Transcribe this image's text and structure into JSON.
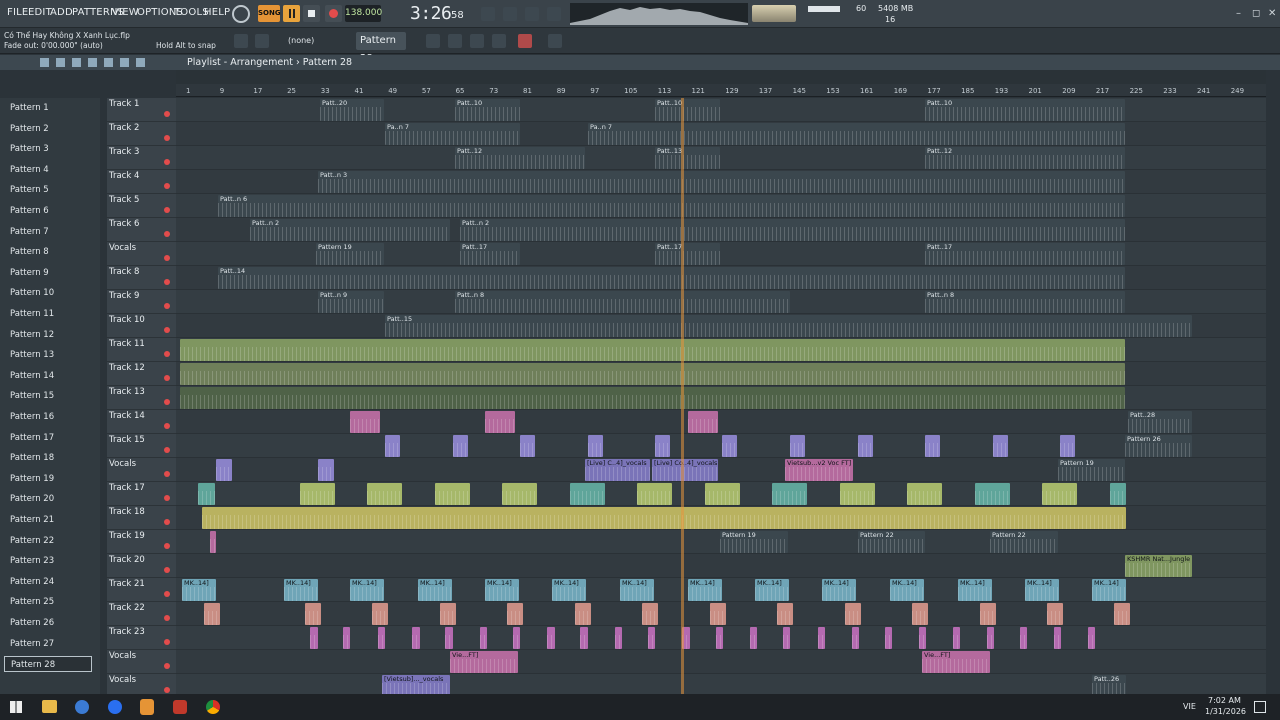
{
  "menu": [
    "FILE",
    "EDIT",
    "ADD",
    "PATTERNS",
    "VIEW",
    "OPTIONS",
    "TOOLS",
    "HELP"
  ],
  "transport": {
    "song_label": "SONG",
    "bpm": "138.000",
    "time": "3:26",
    "time_ms": "58"
  },
  "monitor": {
    "cpu": "60",
    "ram": "5408 MB",
    "poly": "16"
  },
  "hints": {
    "project": "Có Thể Hay Không X Xanh Lục.flp",
    "fade": "Fade out: 0'00.000\" (auto)",
    "snap": "Hold Alt to snap",
    "none": "(none)"
  },
  "pattern_selector": "Pattern 28",
  "playlist_title": "Playlist - Arrangement",
  "playlist_pattern": "Pattern 28",
  "ruler": [
    "1",
    "9",
    "17",
    "25",
    "33",
    "41",
    "49",
    "57",
    "65",
    "73",
    "81",
    "89",
    "97",
    "105",
    "113",
    "121",
    "129",
    "137",
    "145",
    "153",
    "161",
    "169",
    "177",
    "185",
    "193",
    "201",
    "209",
    "217",
    "225",
    "233",
    "241",
    "249"
  ],
  "patterns": [
    "Pattern 1",
    "Pattern 2",
    "Pattern 3",
    "Pattern 4",
    "Pattern 5",
    "Pattern 6",
    "Pattern 7",
    "Pattern 8",
    "Pattern 9",
    "Pattern 10",
    "Pattern 11",
    "Pattern 12",
    "Pattern 13",
    "Pattern 14",
    "Pattern 15",
    "Pattern 16",
    "Pattern 17",
    "Pattern 18",
    "Pattern 19",
    "Pattern 20",
    "Pattern 21",
    "Pattern 22",
    "Pattern 23",
    "Pattern 24",
    "Pattern 25",
    "Pattern 26",
    "Pattern 27",
    "Pattern 28"
  ],
  "selected_pattern": "Pattern 28",
  "tracks": [
    {
      "name": "Track 1",
      "clips": [
        {
          "s": 320,
          "e": 384,
          "label": "Patt..20",
          "c": "#3b474e"
        },
        {
          "s": 455,
          "e": 520,
          "label": "Patt..10",
          "c": "#3b474e"
        },
        {
          "s": 655,
          "e": 720,
          "label": "Patt..10",
          "c": "#3b474e"
        },
        {
          "s": 925,
          "e": 1125,
          "label": "Patt..10",
          "c": "#3b474e"
        }
      ]
    },
    {
      "name": "Track 2",
      "clips": [
        {
          "s": 385,
          "e": 520,
          "label": "Pa..n 7",
          "c": "#3b474e"
        },
        {
          "s": 588,
          "e": 1125,
          "label": "Pa..n 7",
          "c": "#3b474e"
        }
      ]
    },
    {
      "name": "Track 3",
      "clips": [
        {
          "s": 455,
          "e": 585,
          "label": "Patt..12",
          "c": "#3b474e"
        },
        {
          "s": 655,
          "e": 720,
          "label": "Patt..13",
          "c": "#3b474e"
        },
        {
          "s": 925,
          "e": 1125,
          "label": "Patt..12",
          "c": "#3b474e"
        }
      ]
    },
    {
      "name": "Track 4",
      "clips": [
        {
          "s": 318,
          "e": 1125,
          "label": "Patt..n 3",
          "c": "#3b474e"
        }
      ]
    },
    {
      "name": "Track 5",
      "clips": [
        {
          "s": 218,
          "e": 1125,
          "label": "Patt..n 6",
          "c": "#3b474e"
        }
      ]
    },
    {
      "name": "Track 6",
      "clips": [
        {
          "s": 250,
          "e": 450,
          "label": "Patt..n 2",
          "c": "#3b474e"
        },
        {
          "s": 460,
          "e": 1125,
          "label": "Patt..n 2",
          "c": "#3b474e"
        }
      ]
    },
    {
      "name": "Vocals",
      "clips": [
        {
          "s": 316,
          "e": 384,
          "label": "Pattern 19",
          "c": "#3b474e"
        },
        {
          "s": 460,
          "e": 520,
          "label": "Patt..17",
          "c": "#3b474e"
        },
        {
          "s": 655,
          "e": 720,
          "label": "Patt..17",
          "c": "#3b474e"
        },
        {
          "s": 925,
          "e": 1125,
          "label": "Patt..17",
          "c": "#3b474e"
        }
      ]
    },
    {
      "name": "Track 8",
      "clips": [
        {
          "s": 218,
          "e": 1125,
          "label": "Patt..14",
          "c": "#3b474e"
        }
      ]
    },
    {
      "name": "Track 9",
      "clips": [
        {
          "s": 318,
          "e": 384,
          "label": "Patt..n 9",
          "c": "#3b474e"
        },
        {
          "s": 455,
          "e": 790,
          "label": "Patt..n 8",
          "c": "#3b474e"
        },
        {
          "s": 925,
          "e": 1125,
          "label": "Patt..n 8",
          "c": "#3b474e"
        }
      ]
    },
    {
      "name": "Track 10",
      "clips": [
        {
          "s": 385,
          "e": 1192,
          "label": "Patt..15",
          "c": "#3b474e"
        }
      ]
    },
    {
      "name": "Track 11",
      "clips": [
        {
          "s": 180,
          "e": 1125,
          "label": "",
          "c": "#7f9660"
        }
      ]
    },
    {
      "name": "Track 12",
      "clips": [
        {
          "s": 180,
          "e": 1125,
          "label": "",
          "c": "#6f7f5a"
        }
      ]
    },
    {
      "name": "Track 13",
      "clips": [
        {
          "s": 180,
          "e": 1125,
          "label": "",
          "c": "#4f6248"
        }
      ]
    },
    {
      "name": "Track 14",
      "clips": [
        {
          "s": 350,
          "e": 380,
          "label": "",
          "c": "#b46a9d"
        },
        {
          "s": 485,
          "e": 515,
          "label": "",
          "c": "#b46a9d"
        },
        {
          "s": 688,
          "e": 718,
          "label": "",
          "c": "#b46a9d"
        },
        {
          "s": 1128,
          "e": 1192,
          "label": "Patt..28",
          "c": "#3b474e"
        }
      ]
    },
    {
      "name": "Track 15",
      "clips": [
        {
          "s": 385,
          "e": 400,
          "label": "",
          "c": "#8a82c8"
        },
        {
          "s": 453,
          "e": 468,
          "label": "",
          "c": "#8a82c8"
        },
        {
          "s": 520,
          "e": 535,
          "label": "",
          "c": "#8a82c8"
        },
        {
          "s": 588,
          "e": 603,
          "label": "",
          "c": "#8a82c8"
        },
        {
          "s": 655,
          "e": 670,
          "label": "",
          "c": "#8a82c8"
        },
        {
          "s": 722,
          "e": 737,
          "label": "",
          "c": "#8a82c8"
        },
        {
          "s": 790,
          "e": 805,
          "label": "",
          "c": "#8a82c8"
        },
        {
          "s": 858,
          "e": 873,
          "label": "",
          "c": "#8a82c8"
        },
        {
          "s": 925,
          "e": 940,
          "label": "",
          "c": "#8a82c8"
        },
        {
          "s": 993,
          "e": 1008,
          "label": "",
          "c": "#8a82c8"
        },
        {
          "s": 1060,
          "e": 1075,
          "label": "",
          "c": "#8a82c8"
        },
        {
          "s": 1125,
          "e": 1192,
          "label": "Pattern 26",
          "c": "#3b474e"
        }
      ]
    },
    {
      "name": "Vocals",
      "clips": [
        {
          "s": 216,
          "e": 232,
          "label": "",
          "c": "#8a82c8"
        },
        {
          "s": 318,
          "e": 334,
          "label": "",
          "c": "#8a82c8"
        },
        {
          "s": 585,
          "e": 650,
          "label": "[Live] C..4]_vocals",
          "c": "#7a74b8"
        },
        {
          "s": 652,
          "e": 718,
          "label": "[Live] Co..4]_vocals",
          "c": "#7a74b8"
        },
        {
          "s": 785,
          "e": 853,
          "label": "Vietsub...v2 Voc FT]",
          "c": "#b46a9d"
        },
        {
          "s": 1058,
          "e": 1125,
          "label": "Pattern 19",
          "c": "#3b474e"
        }
      ]
    },
    {
      "name": "Track 17",
      "clips": [
        {
          "s": 198,
          "e": 215,
          "label": "",
          "c": "#5fa59a"
        },
        {
          "s": 300,
          "e": 335,
          "label": "",
          "c": "#a6b86a"
        },
        {
          "s": 367,
          "e": 402,
          "label": "",
          "c": "#a6b86a"
        },
        {
          "s": 435,
          "e": 470,
          "label": "",
          "c": "#a6b86a"
        },
        {
          "s": 502,
          "e": 537,
          "label": "",
          "c": "#a6b86a"
        },
        {
          "s": 570,
          "e": 605,
          "label": "",
          "c": "#5fa59a"
        },
        {
          "s": 637,
          "e": 672,
          "label": "",
          "c": "#a6b86a"
        },
        {
          "s": 705,
          "e": 740,
          "label": "",
          "c": "#a6b86a"
        },
        {
          "s": 772,
          "e": 807,
          "label": "",
          "c": "#5fa59a"
        },
        {
          "s": 840,
          "e": 875,
          "label": "",
          "c": "#a6b86a"
        },
        {
          "s": 907,
          "e": 942,
          "label": "",
          "c": "#a6b86a"
        },
        {
          "s": 975,
          "e": 1010,
          "label": "",
          "c": "#5fa59a"
        },
        {
          "s": 1042,
          "e": 1077,
          "label": "",
          "c": "#a6b86a"
        },
        {
          "s": 1110,
          "e": 1126,
          "label": "",
          "c": "#5fa59a"
        }
      ]
    },
    {
      "name": "Track 18",
      "clips": [
        {
          "s": 202,
          "e": 1126,
          "label": "",
          "c": "#b9b260"
        }
      ]
    },
    {
      "name": "Track 19",
      "clips": [
        {
          "s": 210,
          "e": 216,
          "label": "",
          "c": "#b46a9d"
        },
        {
          "s": 720,
          "e": 788,
          "label": "Pattern 19",
          "c": "#3b474e"
        },
        {
          "s": 858,
          "e": 925,
          "label": "Pattern 22",
          "c": "#3b474e"
        },
        {
          "s": 990,
          "e": 1058,
          "label": "Pattern 22",
          "c": "#3b474e"
        }
      ]
    },
    {
      "name": "Track 20",
      "clips": [
        {
          "s": 1125,
          "e": 1192,
          "label": "KSHMR Nat...Jungle",
          "c": "#7f9660"
        }
      ]
    },
    {
      "name": "Track 21",
      "clips": [
        {
          "s": 182,
          "e": 216,
          "label": "MK..14]",
          "c": "#6fa5b7"
        },
        {
          "s": 284,
          "e": 318,
          "label": "MK..14]",
          "c": "#6fa5b7"
        },
        {
          "s": 350,
          "e": 384,
          "label": "MK..14]",
          "c": "#6fa5b7"
        },
        {
          "s": 418,
          "e": 452,
          "label": "MK..14]",
          "c": "#6fa5b7"
        },
        {
          "s": 485,
          "e": 519,
          "label": "MK..14]",
          "c": "#6fa5b7"
        },
        {
          "s": 552,
          "e": 586,
          "label": "MK..14]",
          "c": "#6fa5b7"
        },
        {
          "s": 620,
          "e": 654,
          "label": "MK..14]",
          "c": "#6fa5b7"
        },
        {
          "s": 688,
          "e": 722,
          "label": "MK..14]",
          "c": "#6fa5b7"
        },
        {
          "s": 755,
          "e": 789,
          "label": "MK..14]",
          "c": "#6fa5b7"
        },
        {
          "s": 822,
          "e": 856,
          "label": "MK..14]",
          "c": "#6fa5b7"
        },
        {
          "s": 890,
          "e": 924,
          "label": "MK..14]",
          "c": "#6fa5b7"
        },
        {
          "s": 958,
          "e": 992,
          "label": "MK..14]",
          "c": "#6fa5b7"
        },
        {
          "s": 1025,
          "e": 1059,
          "label": "MK..14]",
          "c": "#6fa5b7"
        },
        {
          "s": 1092,
          "e": 1126,
          "label": "MK..14]",
          "c": "#6fa5b7"
        }
      ]
    },
    {
      "name": "Track 22",
      "clips": [
        {
          "s": 204,
          "e": 220,
          "label": "",
          "c": "#c98e84"
        },
        {
          "s": 305,
          "e": 321,
          "label": "",
          "c": "#c98e84"
        },
        {
          "s": 372,
          "e": 388,
          "label": "",
          "c": "#c98e84"
        },
        {
          "s": 440,
          "e": 456,
          "label": "",
          "c": "#c98e84"
        },
        {
          "s": 507,
          "e": 523,
          "label": "",
          "c": "#c98e84"
        },
        {
          "s": 575,
          "e": 591,
          "label": "",
          "c": "#c98e84"
        },
        {
          "s": 642,
          "e": 658,
          "label": "",
          "c": "#c98e84"
        },
        {
          "s": 710,
          "e": 726,
          "label": "",
          "c": "#c98e84"
        },
        {
          "s": 777,
          "e": 793,
          "label": "",
          "c": "#c98e84"
        },
        {
          "s": 845,
          "e": 861,
          "label": "",
          "c": "#c98e84"
        },
        {
          "s": 912,
          "e": 928,
          "label": "",
          "c": "#c98e84"
        },
        {
          "s": 980,
          "e": 996,
          "label": "",
          "c": "#c98e84"
        },
        {
          "s": 1047,
          "e": 1063,
          "label": "",
          "c": "#c98e84"
        },
        {
          "s": 1114,
          "e": 1130,
          "label": "",
          "c": "#c98e84"
        }
      ]
    },
    {
      "name": "Track 23",
      "clips": [
        {
          "s": 310,
          "e": 318,
          "label": "",
          "c": "#b46ab0"
        },
        {
          "s": 343,
          "e": 350,
          "label": "",
          "c": "#b46ab0"
        },
        {
          "s": 378,
          "e": 385,
          "label": "",
          "c": "#b46ab0"
        },
        {
          "s": 412,
          "e": 420,
          "label": "",
          "c": "#b46ab0"
        },
        {
          "s": 445,
          "e": 453,
          "label": "",
          "c": "#b46ab0"
        },
        {
          "s": 480,
          "e": 487,
          "label": "",
          "c": "#b46ab0"
        },
        {
          "s": 513,
          "e": 520,
          "label": "",
          "c": "#b46ab0"
        },
        {
          "s": 547,
          "e": 555,
          "label": "",
          "c": "#b46ab0"
        },
        {
          "s": 580,
          "e": 588,
          "label": "",
          "c": "#b46ab0"
        },
        {
          "s": 615,
          "e": 622,
          "label": "",
          "c": "#b46ab0"
        },
        {
          "s": 648,
          "e": 655,
          "label": "",
          "c": "#b46ab0"
        },
        {
          "s": 682,
          "e": 690,
          "label": "",
          "c": "#b46ab0"
        },
        {
          "s": 716,
          "e": 723,
          "label": "",
          "c": "#b46ab0"
        },
        {
          "s": 750,
          "e": 757,
          "label": "",
          "c": "#b46ab0"
        },
        {
          "s": 783,
          "e": 790,
          "label": "",
          "c": "#b46ab0"
        },
        {
          "s": 818,
          "e": 825,
          "label": "",
          "c": "#b46ab0"
        },
        {
          "s": 852,
          "e": 859,
          "label": "",
          "c": "#b46ab0"
        },
        {
          "s": 885,
          "e": 892,
          "label": "",
          "c": "#b46ab0"
        },
        {
          "s": 919,
          "e": 926,
          "label": "",
          "c": "#b46ab0"
        },
        {
          "s": 953,
          "e": 960,
          "label": "",
          "c": "#b46ab0"
        },
        {
          "s": 987,
          "e": 994,
          "label": "",
          "c": "#b46ab0"
        },
        {
          "s": 1020,
          "e": 1027,
          "label": "",
          "c": "#b46ab0"
        },
        {
          "s": 1054,
          "e": 1061,
          "label": "",
          "c": "#b46ab0"
        },
        {
          "s": 1088,
          "e": 1095,
          "label": "",
          "c": "#b46ab0"
        }
      ]
    },
    {
      "name": "Vocals",
      "clips": [
        {
          "s": 450,
          "e": 518,
          "label": "Vie...FT]",
          "c": "#b46a9d"
        },
        {
          "s": 922,
          "e": 990,
          "label": "Vie...FT]",
          "c": "#b46a9d"
        }
      ]
    },
    {
      "name": "Vocals",
      "clips": [
        {
          "s": 382,
          "e": 450,
          "label": "[Vietsub]..._vocals",
          "c": "#7a74b8"
        },
        {
          "s": 1092,
          "e": 1126,
          "label": "Patt..26",
          "c": "#3b474e"
        }
      ]
    }
  ],
  "taskbar": {
    "time": "7:02 AM",
    "date": "1/31/2026",
    "lang": "VIE"
  },
  "colors": {
    "accent": "#e59436",
    "playhead": "#e8963c",
    "record": "#e24c4c"
  }
}
